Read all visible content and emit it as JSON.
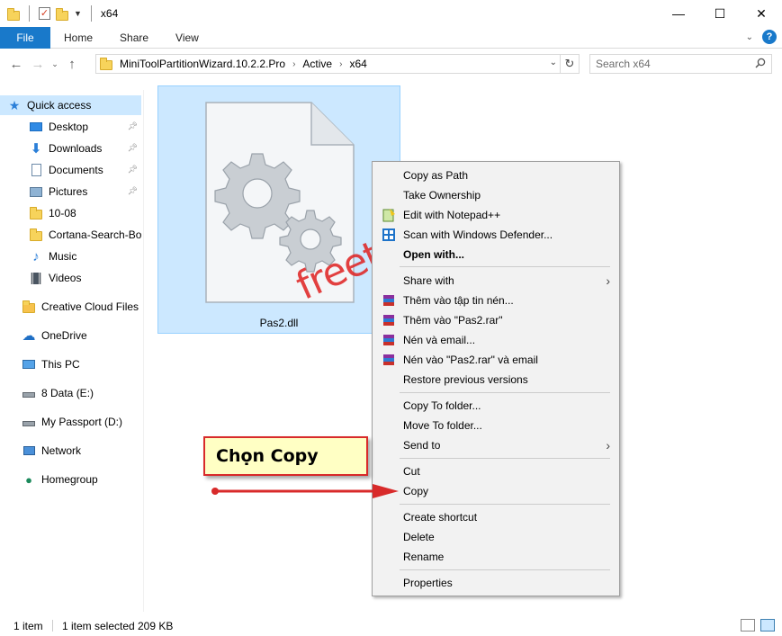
{
  "window": {
    "title": "x64",
    "minimize": "—",
    "maximize": "☐",
    "close": "✕"
  },
  "ribbon": {
    "file": "File",
    "tabs": [
      "Home",
      "Share",
      "View"
    ]
  },
  "address": {
    "crumbs": [
      "MiniToolPartitionWizard.10.2.2.Pro",
      "Active",
      "x64"
    ],
    "search_placeholder": "Search x64"
  },
  "nav": {
    "quick_access": "Quick access",
    "items": [
      {
        "label": "Desktop",
        "pinned": true
      },
      {
        "label": "Downloads",
        "pinned": true
      },
      {
        "label": "Documents",
        "pinned": true
      },
      {
        "label": "Pictures",
        "pinned": true
      },
      {
        "label": "10-08",
        "pinned": false
      },
      {
        "label": "Cortana-Search-Box",
        "pinned": false
      },
      {
        "label": "Music",
        "pinned": false
      },
      {
        "label": "Videos",
        "pinned": false
      }
    ],
    "creative_cloud": "Creative Cloud Files",
    "onedrive": "OneDrive",
    "this_pc": "This PC",
    "drive_e": "8 Data (E:)",
    "drive_d": "My Passport (D:)",
    "network": "Network",
    "homegroup": "Homegroup"
  },
  "file": {
    "name": "Pas2.dll"
  },
  "context_menu": {
    "items": [
      "Copy as Path",
      "Take Ownership",
      "Edit with Notepad++",
      "Scan with Windows Defender...",
      "Open with...",
      "Share with",
      "Thêm vào tập tin nén...",
      "Thêm vào \"Pas2.rar\"",
      "Nén và email...",
      "Nén vào \"Pas2.rar\" và email",
      "Restore previous versions",
      "Copy To folder...",
      "Move To folder...",
      "Send to",
      "Cut",
      "Copy",
      "Create shortcut",
      "Delete",
      "Rename",
      "Properties"
    ]
  },
  "annotation": {
    "callout": "Chọn Copy",
    "watermark": "freetuts.net"
  },
  "status": {
    "count": "1 item",
    "selected": "1 item selected",
    "size": "209 KB"
  },
  "colors": {
    "accent": "#1979ca",
    "selection": "#cce8ff",
    "annotation_red": "#d82a2a",
    "callout_bg": "#ffffc4"
  }
}
